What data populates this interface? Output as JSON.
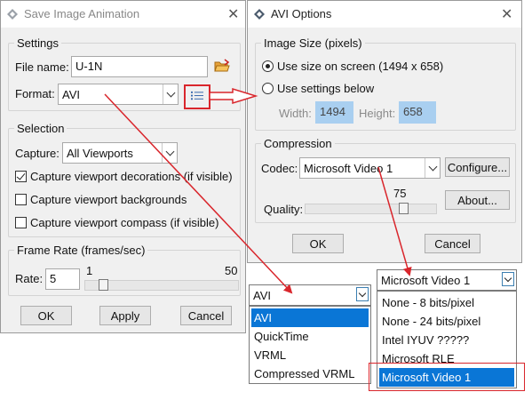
{
  "save_dialog": {
    "title": "Save Image Animation",
    "settings_legend": "Settings",
    "file_name_label": "File name:",
    "file_name_value": "U-1N",
    "format_label": "Format:",
    "format_value": "AVI",
    "selection_legend": "Selection",
    "capture_label": "Capture:",
    "capture_value": "All Viewports",
    "checkboxes": [
      {
        "label": "Capture viewport decorations (if visible)",
        "checked": true
      },
      {
        "label": "Capture viewport backgrounds",
        "checked": false
      },
      {
        "label": "Capture viewport compass (if visible)",
        "checked": false
      }
    ],
    "frame_rate_legend": "Frame Rate (frames/sec)",
    "rate_label": "Rate:",
    "rate_value": "5",
    "rate_min": "1",
    "rate_max": "50",
    "ok_label": "OK",
    "apply_label": "Apply",
    "cancel_label": "Cancel"
  },
  "avi_dialog": {
    "title": "AVI Options",
    "image_size_legend": "Image Size (pixels)",
    "radio_screen_label": "Use size on screen (1494 x 658)",
    "radio_settings_label": "Use settings below",
    "width_label": "Width:",
    "width_value": "1494",
    "height_label": "Height:",
    "height_value": "658",
    "compression_legend": "Compression",
    "codec_label": "Codec:",
    "codec_value": "Microsoft Video 1",
    "configure_label": "Configure...",
    "about_label": "About...",
    "quality_label": "Quality:",
    "quality_value": "75",
    "ok_label": "OK",
    "cancel_label": "Cancel"
  },
  "format_dropdown": {
    "selected": "AVI",
    "options": [
      "AVI",
      "QuickTime",
      "VRML",
      "Compressed VRML"
    ],
    "highlighted_index": 0
  },
  "codec_dropdown": {
    "selected": "Microsoft Video 1",
    "options": [
      "None - 8 bits/pixel",
      "None - 24 bits/pixel",
      "Intel IYUV ?????",
      "Microsoft RLE",
      "Microsoft Video 1"
    ],
    "highlighted_index": 4
  },
  "colors": {
    "annotation_red": "#d9262c",
    "selection_blue": "#0a76d6",
    "field_highlight": "#a9cff0"
  }
}
